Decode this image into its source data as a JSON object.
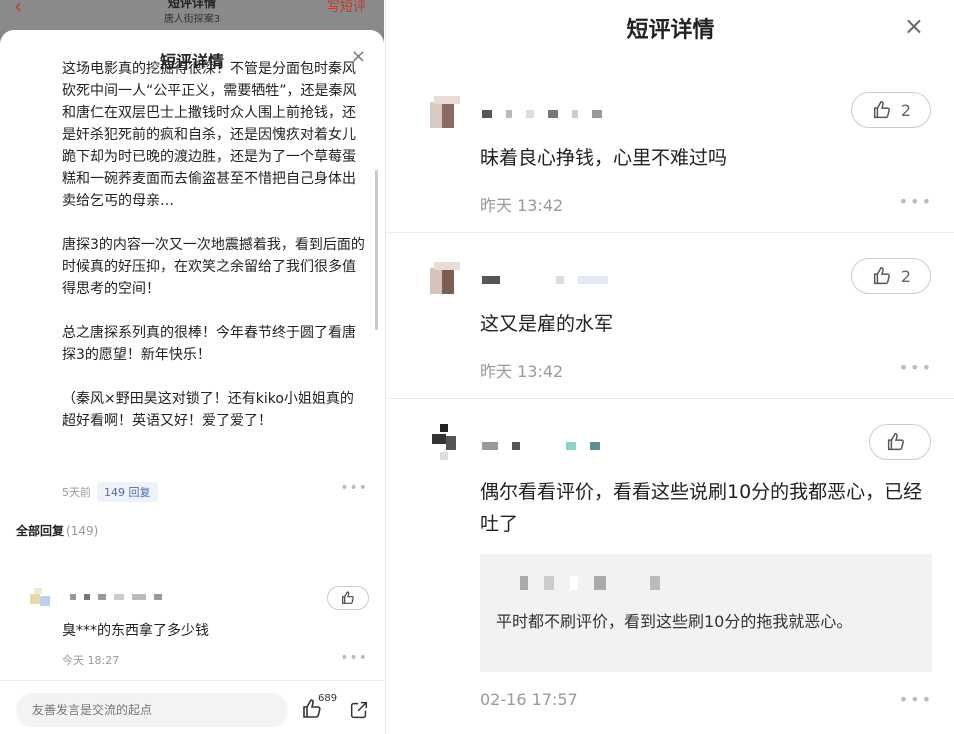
{
  "left": {
    "topbar": {
      "title": "短评详情",
      "subtitle": "唐人街探案3",
      "write_label": "写短评"
    },
    "sheet_title": "短评详情",
    "close_glyph": "×",
    "review_paragraphs": [
      "这场电影真的挖掘得很深！不管是分面包时秦风砍死中间一人“公平正义，需要牺牲”，还是秦风和唐仁在双层巴士上撒钱时众人围上前抢钱，还是奸杀犯死前的疯和自杀，还是因愧疚对着女儿跪下却为时已晚的渡边胜，还是为了一个草莓蛋糕和一碗荞麦面而去偷盗甚至不惜把自己身体出卖给乞丐的母亲…",
      "唐探3的内容一次又一次地震撼着我，看到后面的时候真的好压抑，在欢笑之余留给了我们很多值得思考的空间！",
      "总之唐探系列真的很棒！今年春节终于圆了看唐探3的愿望！新年快乐！",
      "（秦风×野田昊这对锁了！还有kiko小姐姐真的超好看啊！英语又好！爱了爱了！"
    ],
    "review_time": "5天前",
    "reply_pill": "149 回复",
    "all_replies_label": "全部回复",
    "all_replies_count": "(149)",
    "comment": {
      "text": "臭***的东西拿了多少钱",
      "time": "今天 18:27"
    },
    "input_placeholder": "友善发言是交流的起点",
    "like_count": "689"
  },
  "right": {
    "title": "短评详情",
    "close_glyph": "×",
    "comments": [
      {
        "like_count": "2",
        "text": "昧着良心挣钱，心里不难过吗",
        "time": "昨天 13:42"
      },
      {
        "like_count": "2",
        "text": "这又是雇的水军",
        "time": "昨天 13:42"
      },
      {
        "like_count": "",
        "text": "偶尔看看评价，看看这些说刷10分的我都恶心，已经吐了",
        "time": "02-16 17:57"
      }
    ],
    "quote_text": "平时都不刷评价，看到这些刷10分的拖我就恶心。"
  },
  "icons": {
    "thumb": "thumbs-up-icon",
    "share": "share-icon",
    "more": "more-dots-icon",
    "back": "back-chevron-icon",
    "close": "close-icon"
  },
  "colors": {
    "accent_red": "#c23a2b",
    "pill_bg": "#eef2fa",
    "pill_text": "#4a6cb3",
    "muted": "#999999"
  }
}
